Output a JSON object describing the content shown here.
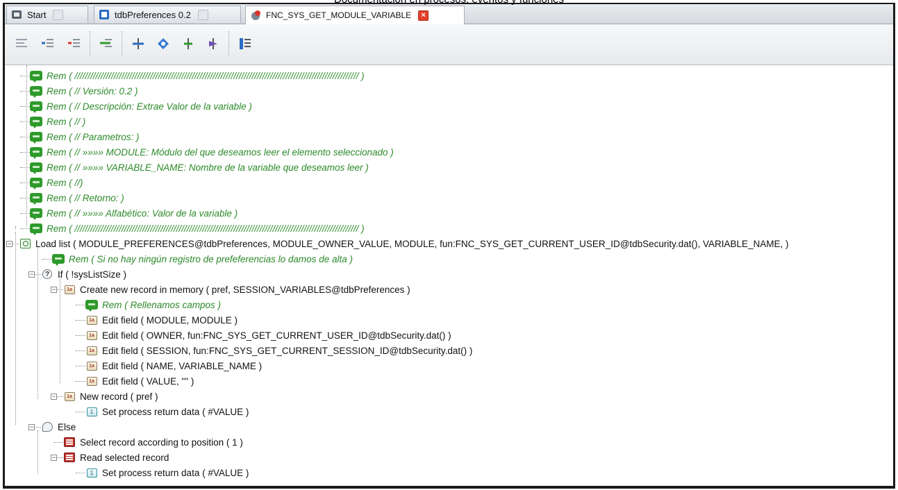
{
  "page_title": "Documentación en procesos, eventos y funciones",
  "tabs": [
    {
      "label": "Start",
      "icon": "start-page-icon",
      "active": false
    },
    {
      "label": "tdbPreferences 0.2",
      "icon": "project-icon",
      "active": false
    },
    {
      "label": "FNC_SYS_GET_MODULE_VARIABLE",
      "icon": "function-icon",
      "active": true
    }
  ],
  "toolbar": {
    "buttons": [
      "align-left-icon",
      "indent-icon",
      "outdent-icon",
      "comment-icon",
      "move-up-icon",
      "move-down-icon",
      "expand-icon",
      "collapse-icon",
      "tree-icon"
    ]
  },
  "colors": {
    "rem": "#2c8a2a",
    "accent": "#e3402a"
  },
  "tree": {
    "rows": [
      {
        "text": "Rem ( ///////////////////////////////////////////////////////////////////////////////////////////////////////////// )",
        "type": "rem"
      },
      {
        "text": "Rem ( // Versión: 0.2 )",
        "type": "rem"
      },
      {
        "text": "Rem ( // Descripción: Extrae Valor de la variable )",
        "type": "rem"
      },
      {
        "text": "Rem ( // )",
        "type": "rem"
      },
      {
        "text": "Rem ( // Parametros: )",
        "type": "rem"
      },
      {
        "text": "Rem ( // »»»» MODULE: Módulo del que deseamos leer el elemento seleccionado )",
        "type": "rem"
      },
      {
        "text": "Rem ( // »»»» VARIABLE_NAME: Nombre de la variable que deseamos leer )",
        "type": "rem"
      },
      {
        "text": "Rem ( //)",
        "type": "rem"
      },
      {
        "text": "Rem ( // Retorno: )",
        "type": "rem"
      },
      {
        "text": "Rem ( // »»»» Alfabético: Valor de la variable )",
        "type": "rem"
      },
      {
        "text": "Rem ( ///////////////////////////////////////////////////////////////////////////////////////////////////////////// )",
        "type": "rem"
      },
      {
        "text": "Load list ( MODULE_PREFERENCES@tdbPreferences, MODULE_OWNER_VALUE, MODULE, fun:FNC_SYS_GET_CURRENT_USER_ID@tdbSecurity.dat(), VARIABLE_NAME, )",
        "type": "load"
      },
      {
        "text": "Rem ( Si no hay ningún registro de prefeferencias lo damos de alta )",
        "type": "rem"
      },
      {
        "text": "If ( !sysListSize )",
        "type": "if"
      },
      {
        "text": "Create new record in memory ( pref, SESSION_VARIABLES@tdbPreferences )",
        "type": "box"
      },
      {
        "text": "Rem ( Rellenamos campos )",
        "type": "rem"
      },
      {
        "text": "Edit field ( MODULE, MODULE )",
        "type": "box"
      },
      {
        "text": "Edit field ( OWNER, fun:FNC_SYS_GET_CURRENT_USER_ID@tdbSecurity.dat() )",
        "type": "box"
      },
      {
        "text": "Edit field ( SESSION, fun:FNC_SYS_GET_CURRENT_SESSION_ID@tdbSecurity.dat() )",
        "type": "box"
      },
      {
        "text": "Edit field ( NAME, VARIABLE_NAME )",
        "type": "box"
      },
      {
        "text": "Edit field ( VALUE, \"\" )",
        "type": "box"
      },
      {
        "text": "New record ( pref )",
        "type": "box"
      },
      {
        "text": "Set process return data ( #VALUE )",
        "type": "set"
      },
      {
        "text": "Else",
        "type": "else"
      },
      {
        "text": "Select record according to position ( 1 )",
        "type": "db"
      },
      {
        "text": "Read selected record",
        "type": "db"
      },
      {
        "text": "Set process return data ( #VALUE )",
        "type": "set"
      }
    ]
  }
}
